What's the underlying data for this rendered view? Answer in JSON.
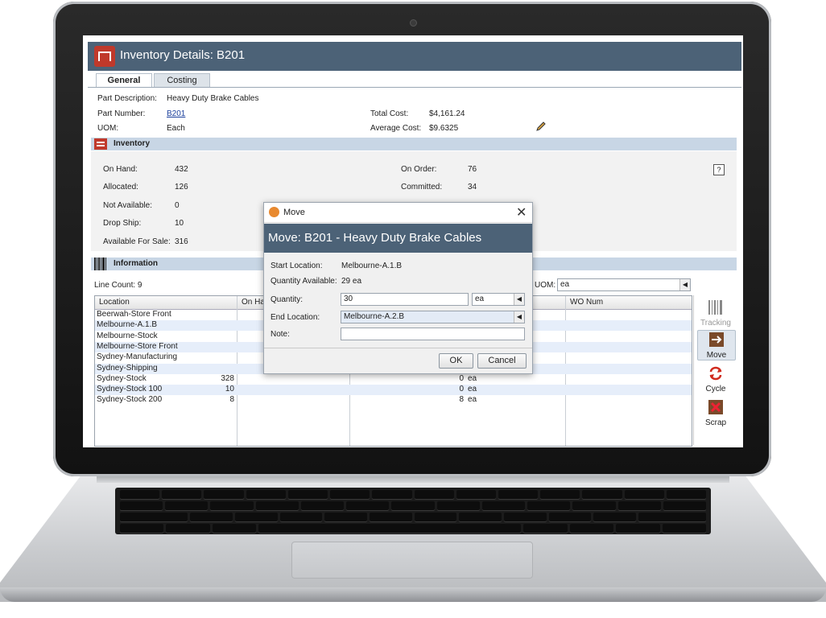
{
  "app": {
    "title": "Inventory Details: B201",
    "tabs": [
      "General",
      "Costing"
    ],
    "active_tab": "General"
  },
  "general": {
    "part_description_label": "Part Description:",
    "part_description": "Heavy Duty Brake Cables",
    "part_number_label": "Part Number:",
    "part_number": "B201",
    "uom_label": "UOM:",
    "uom": "Each",
    "total_cost_label": "Total Cost:",
    "total_cost": "$4,161.24",
    "average_cost_label": "Average Cost:",
    "average_cost": "$9.6325"
  },
  "inventory": {
    "section_title": "Inventory",
    "on_hand_label": "On Hand:",
    "on_hand": "432",
    "allocated_label": "Allocated:",
    "allocated": "126",
    "not_available_label": "Not Available:",
    "not_available": "0",
    "drop_ship_label": "Drop Ship:",
    "drop_ship": "10",
    "available_for_sale_label": "Available For Sale:",
    "available_for_sale": "316",
    "on_order_label": "On Order:",
    "on_order": "76",
    "committed_label": "Committed:",
    "committed": "34"
  },
  "information": {
    "section_title": "Information",
    "line_count": "Line Count: 9",
    "uom_label": "UOM:",
    "uom_value": "ea",
    "columns": [
      "Location",
      "On Ha",
      "WO Num"
    ],
    "rows": [
      {
        "location": "Beerwah-Store Front",
        "on_hand": "",
        "qty": "",
        "uom": ""
      },
      {
        "location": "Melbourne-A.1.B",
        "on_hand": "",
        "qty": "",
        "uom": ""
      },
      {
        "location": "Melbourne-Stock",
        "on_hand": "",
        "qty": "",
        "uom": ""
      },
      {
        "location": "Melbourne-Store Front",
        "on_hand": "",
        "qty": "",
        "uom": ""
      },
      {
        "location": "Sydney-Manufacturing",
        "on_hand": "",
        "qty": "",
        "uom": ""
      },
      {
        "location": "Sydney-Shipping",
        "on_hand": "",
        "qty": "",
        "uom": ""
      },
      {
        "location": "Sydney-Stock",
        "on_hand": "328",
        "qty": "0",
        "uom": "ea"
      },
      {
        "location": "Sydney-Stock 100",
        "on_hand": "10",
        "qty": "0",
        "uom": "ea"
      },
      {
        "location": "Sydney-Stock 200",
        "on_hand": "8",
        "qty": "8",
        "uom": "ea"
      }
    ]
  },
  "toolbar": {
    "tracking": "Tracking",
    "move": "Move",
    "cycle": "Cycle",
    "scrap": "Scrap"
  },
  "dialog": {
    "window_title": "Move",
    "header": "Move: B201 - Heavy Duty Brake Cables",
    "start_location_label": "Start Location:",
    "start_location": "Melbourne-A.1.B",
    "quantity_available_label": "Quantity Available:",
    "quantity_available": "29 ea",
    "quantity_label": "Quantity:",
    "quantity": "30",
    "quantity_uom": "ea",
    "end_location_label": "End Location:",
    "end_location": "Melbourne-A.2.B",
    "note_label": "Note:",
    "note": "",
    "ok": "OK",
    "cancel": "Cancel"
  },
  "colors": {
    "header_bg": "#4c6277",
    "section_bg": "#c8d6e5",
    "row_highlight": "#e6eefa",
    "brand_red": "#c0392b"
  }
}
